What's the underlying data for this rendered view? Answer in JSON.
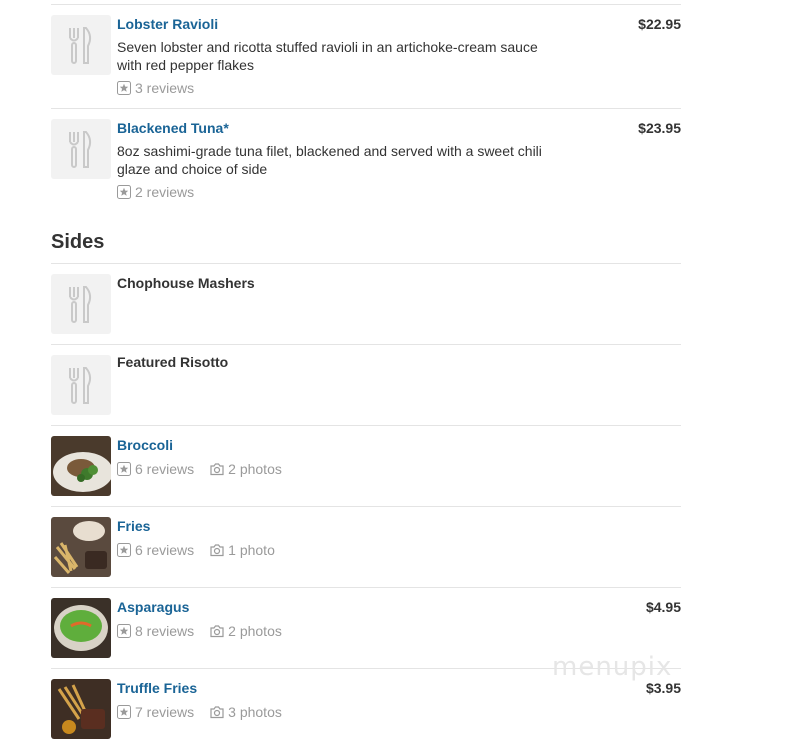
{
  "entrees": [
    {
      "name": "Lobster Ravioli",
      "price": "$22.95",
      "description_line1": "Seven lobster and ricotta stuffed ravioli in an artichoke-cream sauce",
      "description_line2": "with red pepper flakes",
      "reviews": "3 reviews"
    },
    {
      "name": "Blackened Tuna*",
      "price": "$23.95",
      "description_line1": "8oz sashimi-grade tuna filet, blackened and served with a sweet chili",
      "description_line2": "glaze and choice of side",
      "reviews": "2 reviews"
    }
  ],
  "sides_section": {
    "title": "Sides",
    "items": [
      {
        "name": "Chophouse Mashers"
      },
      {
        "name": "Featured Risotto"
      },
      {
        "name": "Broccoli",
        "reviews": "6 reviews",
        "photos": "2 photos"
      },
      {
        "name": "Fries",
        "reviews": "6 reviews",
        "photos": "1 photo"
      },
      {
        "name": "Asparagus",
        "price": "$4.95",
        "reviews": "8 reviews",
        "photos": "2 photos"
      },
      {
        "name": "Truffle Fries",
        "price": "$3.95",
        "reviews": "7 reviews",
        "photos": "3 photos"
      }
    ]
  },
  "watermark": "menupix",
  "colors": {
    "link": "#1a6496",
    "meta": "#9a9a9a",
    "divider": "#e4e4e4"
  }
}
